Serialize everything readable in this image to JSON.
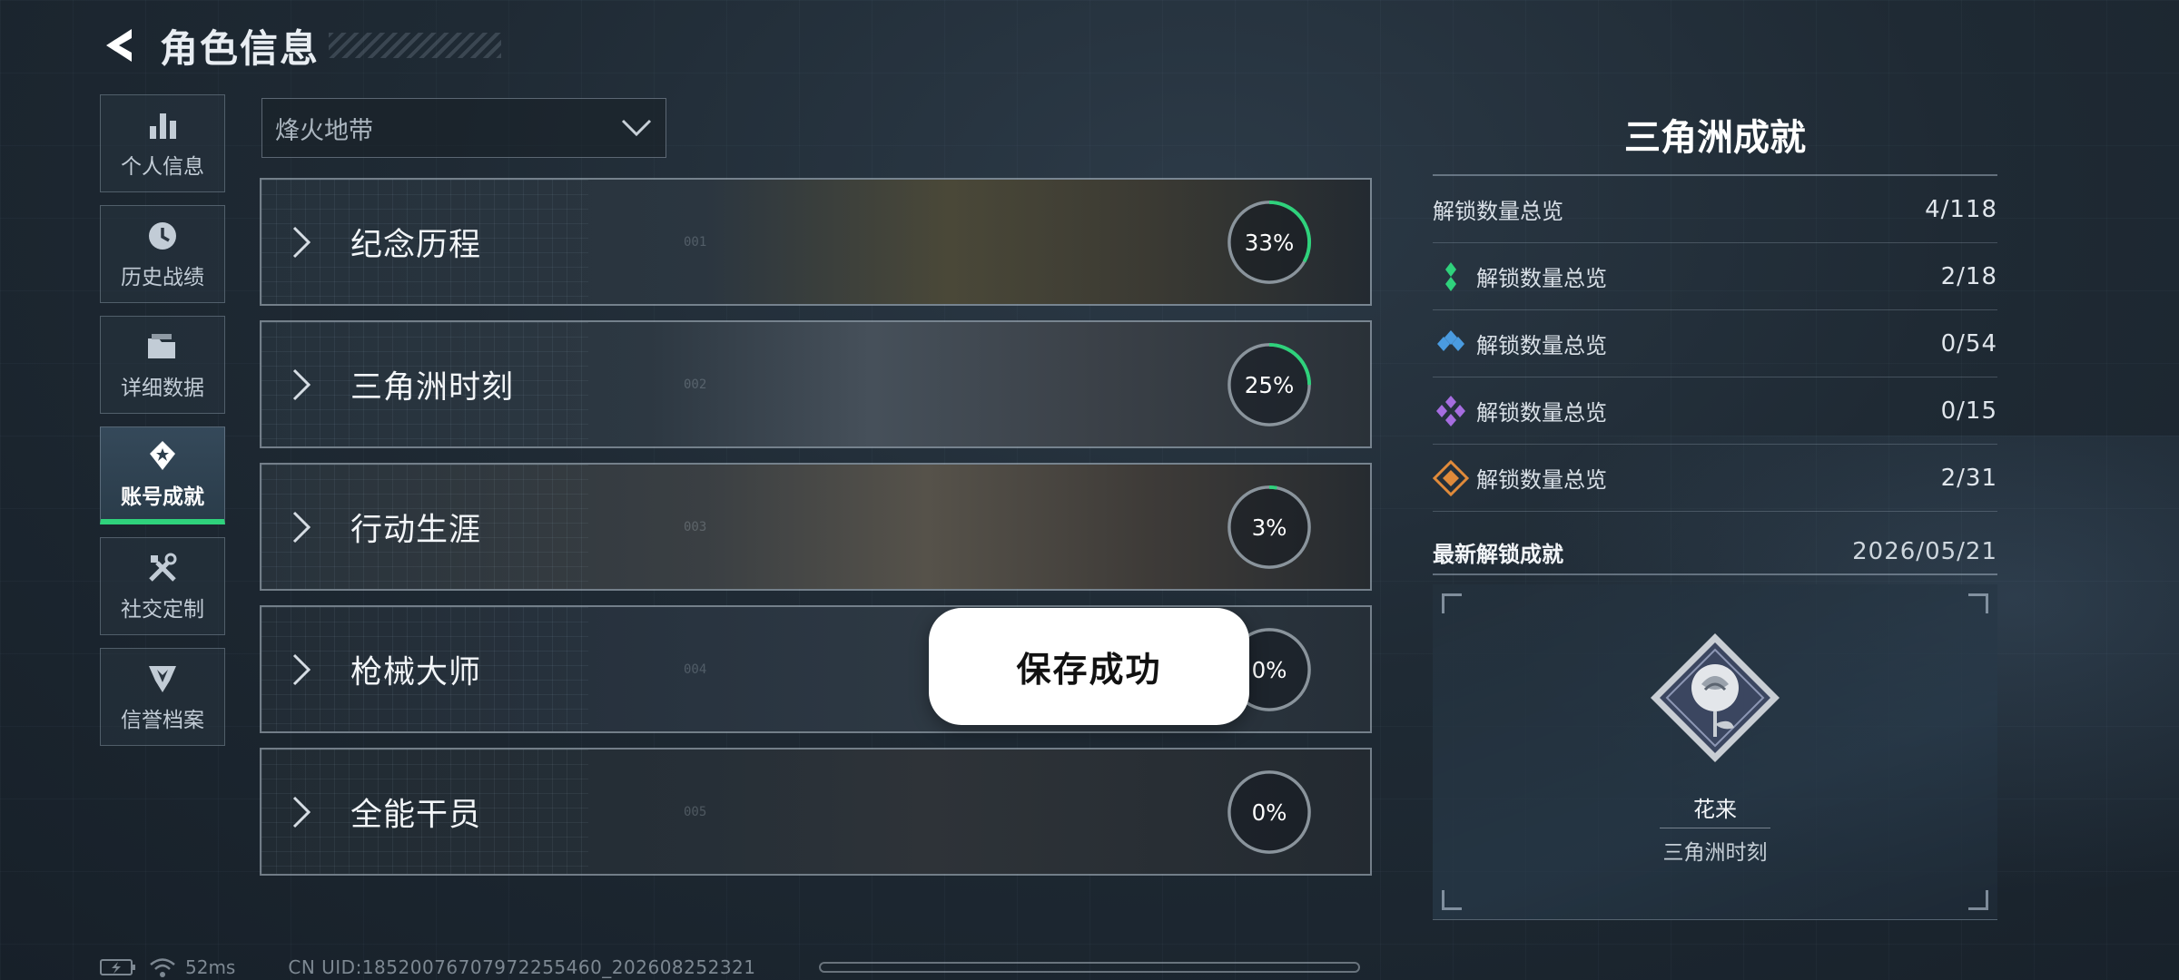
{
  "header": {
    "title": "角色信息"
  },
  "sidebar": {
    "items": [
      {
        "label": "个人信息",
        "icon": "bar-chart-icon"
      },
      {
        "label": "历史战绩",
        "icon": "clock-icon"
      },
      {
        "label": "详细数据",
        "icon": "folder-icon"
      },
      {
        "label": "账号成就",
        "icon": "achievement-badge-icon",
        "active": true
      },
      {
        "label": "社交定制",
        "icon": "tools-icon"
      },
      {
        "label": "信誉档案",
        "icon": "shield-emblem-icon"
      }
    ]
  },
  "mode_select": {
    "value": "烽火地带"
  },
  "categories": [
    {
      "label": "纪念历程",
      "num": "001",
      "progress": 33,
      "progress_text": "33%"
    },
    {
      "label": "三角洲时刻",
      "num": "002",
      "progress": 25,
      "progress_text": "25%"
    },
    {
      "label": "行动生涯",
      "num": "003",
      "progress": 3,
      "progress_text": "3%"
    },
    {
      "label": "枪械大师",
      "num": "004",
      "progress": 0,
      "progress_text": "0%"
    },
    {
      "label": "全能干员",
      "num": "005",
      "progress": 0,
      "progress_text": "0%"
    }
  ],
  "toast": {
    "text": "保存成功"
  },
  "panel": {
    "title": "三角洲成就",
    "summary": {
      "label": "解锁数量总览",
      "value": "4/118"
    },
    "tiers": [
      {
        "label": "解锁数量总览",
        "value": "2/18",
        "color": "#2fd27c"
      },
      {
        "label": "解锁数量总览",
        "value": "0/54",
        "color": "#4a9be0"
      },
      {
        "label": "解锁数量总览",
        "value": "0/15",
        "color": "#a66de0"
      },
      {
        "label": "解锁数量总览",
        "value": "2/31",
        "color": "#e08a3a"
      }
    ],
    "latest": {
      "label": "最新解锁成就",
      "date": "2026/05/21",
      "name": "花来",
      "category": "三角洲时刻"
    }
  },
  "footer": {
    "ping": "52ms",
    "uid": "CN UID:1852007670797225546​0_202608252321"
  },
  "colors": {
    "accent": "#2fd27c",
    "ring_track": "#8a949c"
  }
}
